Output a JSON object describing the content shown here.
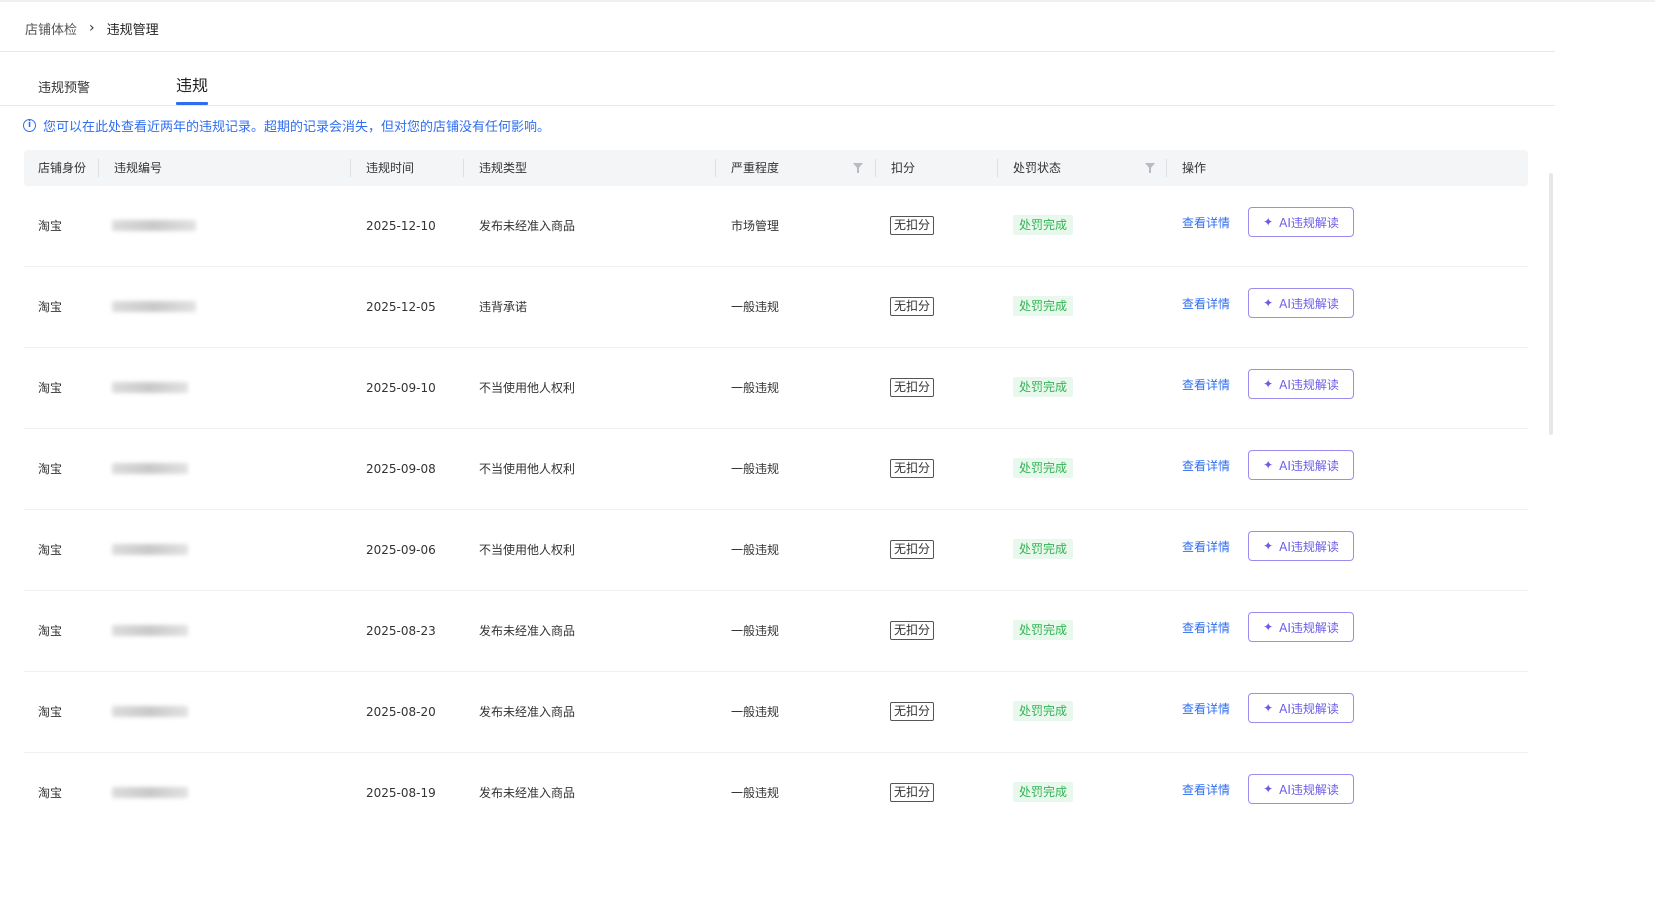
{
  "breadcrumb": {
    "parent": "店铺体检",
    "separator": "›",
    "current": "违规管理"
  },
  "tabs": [
    {
      "label": "违规预警"
    },
    {
      "label": "违规"
    }
  ],
  "notice": {
    "text": "您可以在此处查看近两年的违规记录。超期的记录会消失，但对您的店铺没有任何影响。"
  },
  "table": {
    "columns": [
      "店铺身份",
      "违规编号",
      "违规时间",
      "违规类型",
      "严重程度",
      "扣分",
      "处罚状态",
      "操作"
    ],
    "rows": [
      {
        "shop": "淘宝",
        "time": "2025-12-10",
        "type": "发布未经准入商品",
        "severity": "市场管理",
        "score": "无扣分",
        "status": "处罚完成",
        "detail": "查看详情",
        "ai": "AI违规解读"
      },
      {
        "shop": "淘宝",
        "time": "2025-12-05",
        "type": "违背承诺",
        "severity": "一般违规",
        "score": "无扣分",
        "status": "处罚完成",
        "detail": "查看详情",
        "ai": "AI违规解读"
      },
      {
        "shop": "淘宝",
        "time": "2025-09-10",
        "type": "不当使用他人权利",
        "severity": "一般违规",
        "score": "无扣分",
        "status": "处罚完成",
        "detail": "查看详情",
        "ai": "AI违规解读"
      },
      {
        "shop": "淘宝",
        "time": "2025-09-08",
        "type": "不当使用他人权利",
        "severity": "一般违规",
        "score": "无扣分",
        "status": "处罚完成",
        "detail": "查看详情",
        "ai": "AI违规解读"
      },
      {
        "shop": "淘宝",
        "time": "2025-09-06",
        "type": "不当使用他人权利",
        "severity": "一般违规",
        "score": "无扣分",
        "status": "处罚完成",
        "detail": "查看详情",
        "ai": "AI违规解读"
      },
      {
        "shop": "淘宝",
        "time": "2025-08-23",
        "type": "发布未经准入商品",
        "severity": "一般违规",
        "score": "无扣分",
        "status": "处罚完成",
        "detail": "查看详情",
        "ai": "AI违规解读"
      },
      {
        "shop": "淘宝",
        "time": "2025-08-20",
        "type": "发布未经准入商品",
        "severity": "一般违规",
        "score": "无扣分",
        "status": "处罚完成",
        "detail": "查看详情",
        "ai": "AI违规解读"
      },
      {
        "shop": "淘宝",
        "time": "2025-08-19",
        "type": "发布未经准入商品",
        "severity": "一般违规",
        "score": "无扣分",
        "status": "处罚完成",
        "detail": "查看详情",
        "ai": "AI违规解读"
      }
    ]
  },
  "colors": {
    "accent": "#2f6ef0",
    "success": "#34b356",
    "ai": "#6b5ce7"
  }
}
